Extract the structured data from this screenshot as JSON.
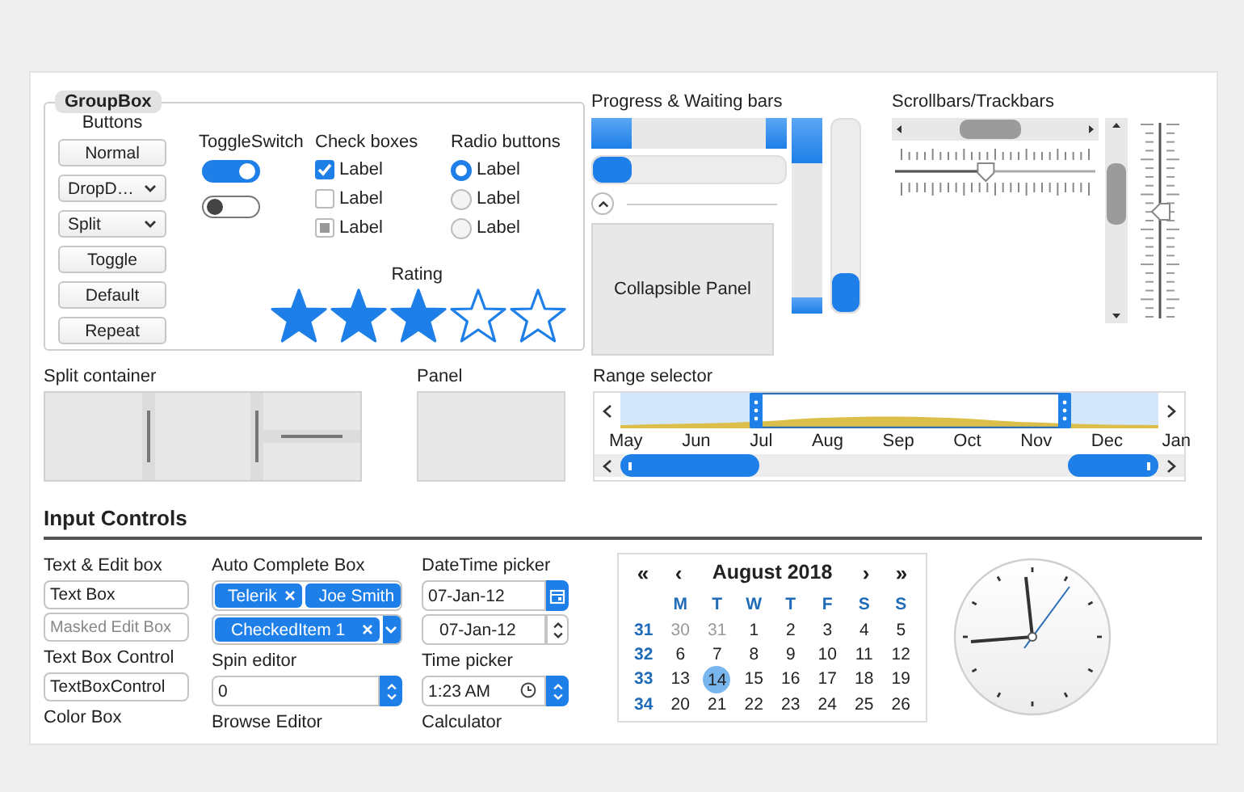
{
  "groupbox": {
    "title": "GroupBox",
    "buttons": {
      "label": "Buttons",
      "items": [
        {
          "label": "Normal",
          "kind": "push"
        },
        {
          "label": "DropD…",
          "kind": "dropdown"
        },
        {
          "label": "Split",
          "kind": "split"
        },
        {
          "label": "Toggle",
          "kind": "push"
        },
        {
          "label": "Default",
          "kind": "push"
        },
        {
          "label": "Repeat",
          "kind": "push"
        }
      ]
    },
    "toggle_switches": {
      "label": "ToggleSwitch",
      "items": [
        {
          "on": true
        },
        {
          "on": false
        }
      ]
    },
    "check_boxes": {
      "label": "Check boxes",
      "items": [
        {
          "label": "Label",
          "checked": true,
          "indeterminate": false
        },
        {
          "label": "Label",
          "checked": false,
          "indeterminate": false
        },
        {
          "label": "Label",
          "checked": false,
          "indeterminate": true
        }
      ]
    },
    "radio_buttons": {
      "label": "Radio buttons",
      "items": [
        {
          "label": "Label",
          "selected": true
        },
        {
          "label": "Label",
          "selected": false
        },
        {
          "label": "Label",
          "selected": false
        }
      ]
    },
    "rating": {
      "label": "Rating",
      "stars": 3
    }
  },
  "progress": {
    "title": "Progress & Waiting bars",
    "horizontal_bars": [
      {
        "kind": "waiting"
      },
      {
        "kind": "progress",
        "level": 0.2
      }
    ],
    "vertical_bars": [
      {
        "kind": "waiting"
      },
      {
        "kind": "progress",
        "level": 0.2
      }
    ],
    "collapsible_panel": {
      "label": "Collapsible Panel",
      "expanded": true
    }
  },
  "scrollbars": {
    "title": "Scrollbars/Trackbars",
    "horizontal_trackbar": {
      "level": 0.45
    },
    "vertical_trackbar": {
      "level": 0.55
    }
  },
  "split_container": {
    "title": "Split container"
  },
  "panel": {
    "title": "Panel"
  },
  "range_selector": {
    "title": "Range selector",
    "months": [
      "May",
      "Jun",
      "Jul",
      "Aug",
      "Sep",
      "Oct",
      "Nov",
      "Dec",
      "Jan"
    ]
  },
  "input_controls": {
    "title": "Input Controls",
    "columns": [
      {
        "items": [
          {
            "kind": "label",
            "text": "Text & Edit box"
          },
          {
            "kind": "textbox",
            "value": "Text Box"
          },
          {
            "kind": "textbox",
            "placeholder": "Masked Edit Box"
          },
          {
            "kind": "label",
            "text": "Text Box Control"
          },
          {
            "kind": "textbox",
            "value": "TextBoxControl"
          },
          {
            "kind": "label",
            "text": "Color Box"
          }
        ]
      },
      {
        "items": [
          {
            "kind": "label",
            "text": "Auto Complete Box"
          },
          {
            "kind": "tokens",
            "tokens": [
              "Telerik",
              "Joe Smith"
            ]
          },
          {
            "kind": "checked_dropdown",
            "tokens": [
              "CheckedItem 1"
            ]
          },
          {
            "kind": "label",
            "text": "Spin editor"
          },
          {
            "kind": "spin",
            "value": "0"
          },
          {
            "kind": "label",
            "text": "Browse Editor"
          }
        ]
      },
      {
        "items": [
          {
            "kind": "label",
            "text": "DateTime picker"
          },
          {
            "kind": "date",
            "value": "07-Jan-12"
          },
          {
            "kind": "date_spin",
            "value": "07-Jan-12"
          },
          {
            "kind": "label",
            "text": "Time picker"
          },
          {
            "kind": "time",
            "value": "1:23 AM"
          },
          {
            "kind": "label",
            "text": "Calculator"
          }
        ]
      }
    ],
    "calendar": {
      "title": "August 2018",
      "nav": [
        "«",
        "‹",
        "›",
        "»"
      ],
      "weekdays": [
        "M",
        "T",
        "W",
        "T",
        "F",
        "S",
        "S"
      ],
      "weeks": [
        {
          "number": "31",
          "days": [
            {
              "day": "30",
              "other_month": true,
              "selected": false
            },
            {
              "day": "31",
              "other_month": true,
              "selected": false
            },
            {
              "day": "1",
              "other_month": false,
              "selected": false
            },
            {
              "day": "2",
              "other_month": false,
              "selected": false
            },
            {
              "day": "3",
              "other_month": false,
              "selected": false
            },
            {
              "day": "4",
              "other_month": false,
              "selected": false
            },
            {
              "day": "5",
              "other_month": false,
              "selected": false
            }
          ]
        },
        {
          "number": "32",
          "days": [
            {
              "day": "6",
              "other_month": false,
              "selected": false
            },
            {
              "day": "7",
              "other_month": false,
              "selected": false
            },
            {
              "day": "8",
              "other_month": false,
              "selected": false
            },
            {
              "day": "9",
              "other_month": false,
              "selected": false
            },
            {
              "day": "10",
              "other_month": false,
              "selected": false
            },
            {
              "day": "11",
              "other_month": false,
              "selected": false
            },
            {
              "day": "12",
              "other_month": false,
              "selected": false
            }
          ]
        },
        {
          "number": "33",
          "days": [
            {
              "day": "13",
              "other_month": false,
              "selected": false
            },
            {
              "day": "14",
              "other_month": false,
              "selected": true
            },
            {
              "day": "15",
              "other_month": false,
              "selected": false
            },
            {
              "day": "16",
              "other_month": false,
              "selected": false
            },
            {
              "day": "17",
              "other_month": false,
              "selected": false
            },
            {
              "day": "18",
              "other_month": false,
              "selected": false
            },
            {
              "day": "19",
              "other_month": false,
              "selected": false
            }
          ]
        },
        {
          "number": "34",
          "days": [
            {
              "day": "20",
              "other_month": false,
              "selected": false
            },
            {
              "day": "21",
              "other_month": false,
              "selected": false
            },
            {
              "day": "22",
              "other_month": false,
              "selected": false
            },
            {
              "day": "23",
              "other_month": false,
              "selected": false
            },
            {
              "day": "24",
              "other_month": false,
              "selected": false
            },
            {
              "day": "25",
              "other_month": false,
              "selected": false
            },
            {
              "day": "26",
              "other_month": false,
              "selected": false
            }
          ]
        }
      ]
    }
  }
}
